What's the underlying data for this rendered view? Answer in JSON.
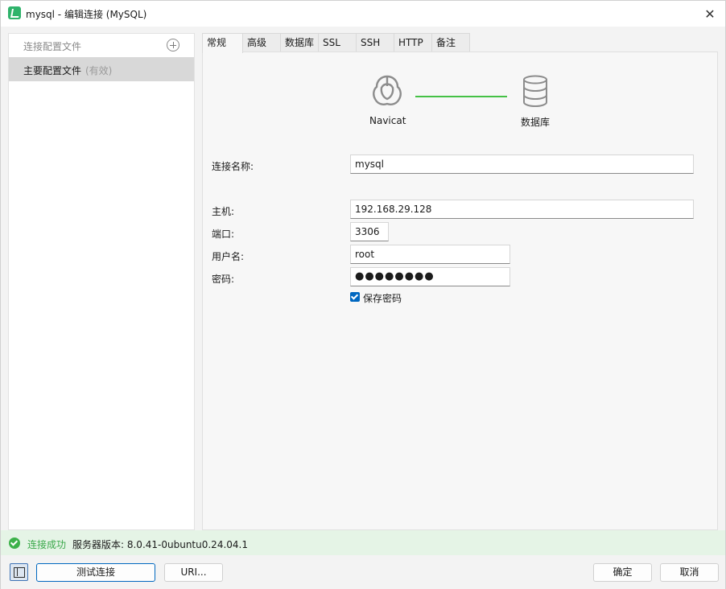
{
  "window": {
    "title": "mysql - 编辑连接 (MySQL)"
  },
  "sidebar": {
    "header_label": "连接配置文件",
    "items": [
      {
        "label": "主要配置文件",
        "status": "(有效)"
      }
    ]
  },
  "tabs": [
    {
      "label": "常规",
      "active": true
    },
    {
      "label": "高级"
    },
    {
      "label": "数据库"
    },
    {
      "label": "SSL"
    },
    {
      "label": "SSH"
    },
    {
      "label": "HTTP"
    },
    {
      "label": "备注"
    }
  ],
  "diagram": {
    "left_label": "Navicat",
    "right_label": "数据库",
    "line_color": "#45c146"
  },
  "form": {
    "connection_name_label": "连接名称:",
    "connection_name_value": "mysql",
    "host_label": "主机:",
    "host_value": "192.168.29.128",
    "port_label": "端口:",
    "port_value": "3306",
    "username_label": "用户名:",
    "username_value": "root",
    "password_label": "密码:",
    "password_value": "●●●●●●●●",
    "save_password_label": "保存密码",
    "save_password_checked": true
  },
  "status": {
    "success_text": "连接成功",
    "version_text": "服务器版本: 8.0.41-0ubuntu0.24.04.1",
    "color": "#3aa84a"
  },
  "buttons": {
    "test_connection": "测试连接",
    "uri": "URI...",
    "ok": "确定",
    "cancel": "取消"
  }
}
